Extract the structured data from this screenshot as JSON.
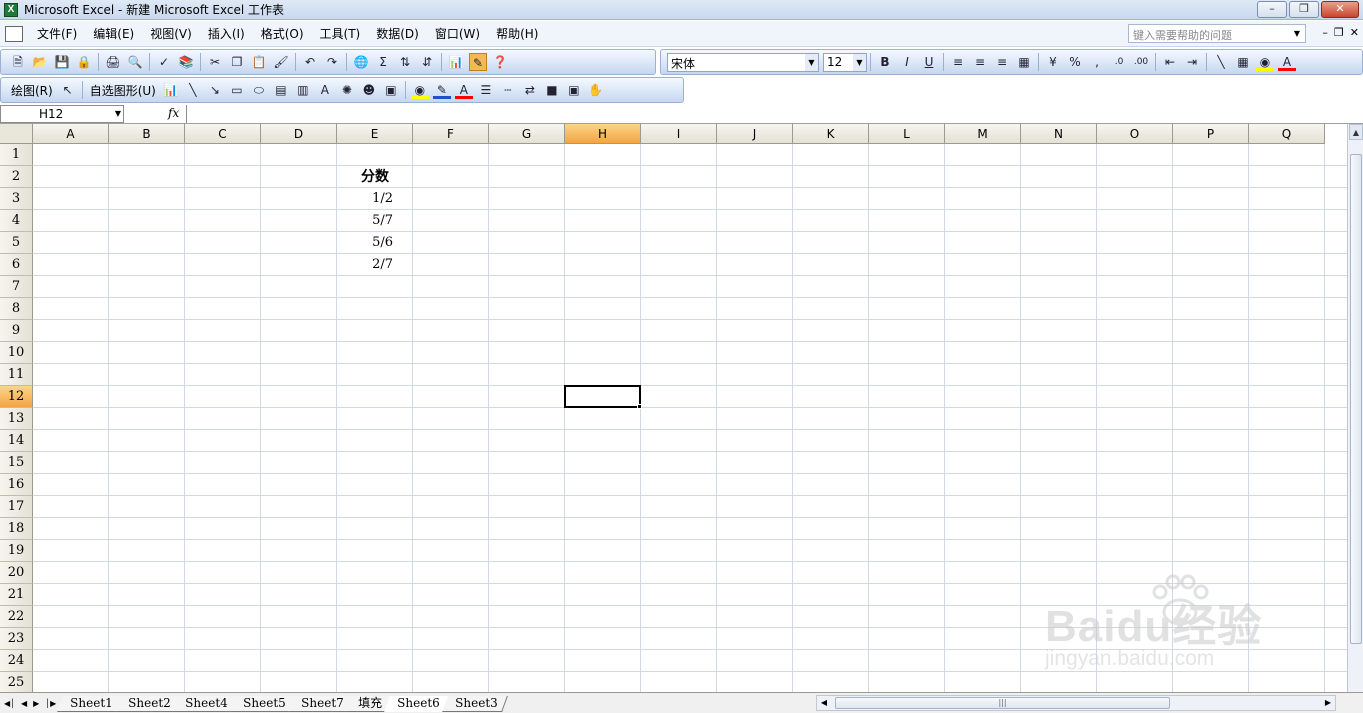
{
  "window": {
    "title": "Microsoft Excel - 新建 Microsoft Excel 工作表",
    "app_icon": "X"
  },
  "menubar": {
    "items": [
      "文件(F)",
      "编辑(E)",
      "视图(V)",
      "插入(I)",
      "格式(O)",
      "工具(T)",
      "数据(D)",
      "窗口(W)",
      "帮助(H)"
    ],
    "help_placeholder": "键入需要帮助的问题"
  },
  "toolbar_format": {
    "font_name": "宋体",
    "font_size": "12"
  },
  "drawing_toolbar": {
    "draw_label": "绘图(R)",
    "autoshape_label": "自选图形(U)"
  },
  "formula_bar": {
    "name_box": "H12",
    "fx_label": "fx",
    "formula": ""
  },
  "grid": {
    "columns": [
      "A",
      "B",
      "C",
      "D",
      "E",
      "F",
      "G",
      "H",
      "I",
      "J",
      "K",
      "L",
      "M",
      "N",
      "O",
      "P",
      "Q"
    ],
    "rows": [
      "1",
      "2",
      "3",
      "4",
      "5",
      "6",
      "7",
      "8",
      "9",
      "10",
      "11",
      "12",
      "13",
      "14",
      "15",
      "16",
      "17",
      "18",
      "19",
      "20",
      "21",
      "22",
      "23",
      "24",
      "25"
    ],
    "selected_column": "H",
    "selected_row": "12",
    "cells": {
      "E2": "分数",
      "E3": "1/2",
      "E4": "5/7",
      "E5": "5/6",
      "E6": "2/7"
    }
  },
  "sheet_tabs": {
    "tabs": [
      "Sheet1",
      "Sheet2",
      "Sheet4",
      "Sheet5",
      "Sheet7",
      "填充",
      "Sheet6",
      "Sheet3"
    ],
    "active": "Sheet6"
  },
  "watermark": {
    "logo": "Baidu经验",
    "url": "jingyan.baidu.com"
  }
}
